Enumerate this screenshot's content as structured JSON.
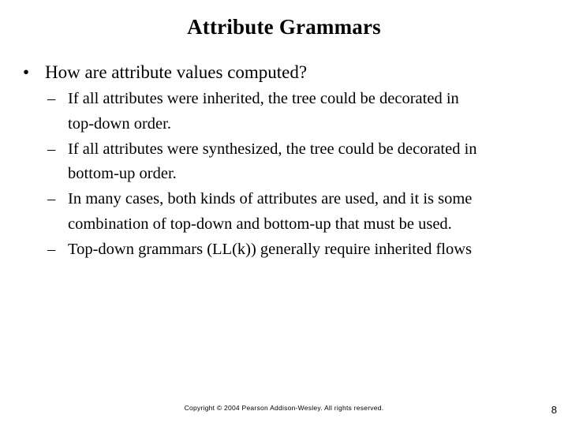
{
  "slide": {
    "title": "Attribute Grammars",
    "bullet_glyph": "•",
    "dash_glyph": "–",
    "main_bullet": {
      "text": "How are attribute values computed?"
    },
    "sub_bullets": [
      {
        "text": "If all attributes were inherited, the tree could be decorated in top-down order.",
        "lines": [
          "If all attributes were inherited, the tree could be decorated in",
          "top-down order."
        ]
      },
      {
        "text": "If all attributes were synthesized, the tree could be decorated in bottom-up order.",
        "lines": [
          "If all attributes were synthesized, the tree could be decorated in",
          "bottom-up order."
        ]
      },
      {
        "text": "In many cases, both kinds of attributes are used, and it is some combination of top-down and bottom-up that must be used.",
        "lines": [
          "In many cases, both kinds of attributes are used, and it is some",
          "combination of top-down and bottom-up that must be used."
        ]
      },
      {
        "text": "Top-down grammars (LL(k)) generally require inherited flows",
        "lines": [
          "Top-down grammars (LL(k)) generally require inherited flows"
        ]
      }
    ],
    "footer": {
      "copyright": "Copyright © 2004 Pearson Addison-Wesley. All rights reserved.",
      "page_number": "8"
    },
    "colors": {
      "background": "#ffffff",
      "text": "#000000"
    }
  }
}
